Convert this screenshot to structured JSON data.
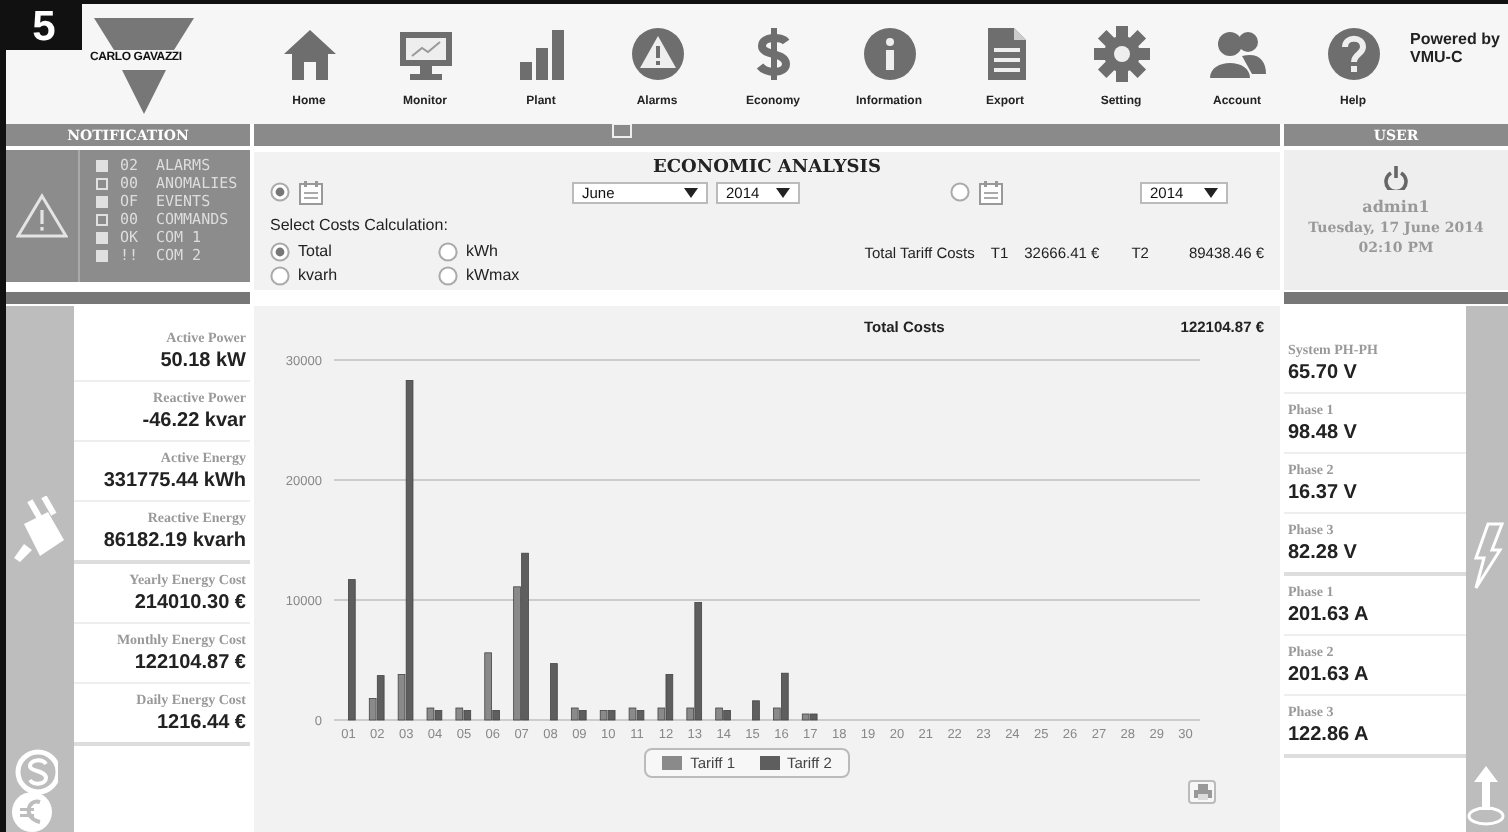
{
  "figure_badge": "5",
  "logo": "CARLO GAVAZZI",
  "nav": [
    {
      "label": "Home"
    },
    {
      "label": "Monitor"
    },
    {
      "label": "Plant"
    },
    {
      "label": "Alarms"
    },
    {
      "label": "Economy"
    },
    {
      "label": "Information"
    },
    {
      "label": "Export"
    },
    {
      "label": "Setting"
    },
    {
      "label": "Account"
    },
    {
      "label": "Help"
    }
  ],
  "powered_by": [
    "Powered by",
    "VMU-C"
  ],
  "notification": {
    "title": "NOTIFICATION",
    "items": [
      {
        "active": true,
        "code": "02",
        "label": "ALARMS"
      },
      {
        "active": false,
        "code": "00",
        "label": "ANOMALIES"
      },
      {
        "active": true,
        "code": "OF",
        "label": "EVENTS"
      },
      {
        "active": false,
        "code": "00",
        "label": "COMMANDS"
      },
      {
        "active": true,
        "code": "OK",
        "label": "COM 1"
      },
      {
        "active": true,
        "code": "!!",
        "label": "COM 2"
      }
    ]
  },
  "user": {
    "title": "USER",
    "name": "admin1",
    "date": "Tuesday, 17 June 2014",
    "time": "02:10 PM"
  },
  "analysis": {
    "title": "ECONOMIC ANALYSIS",
    "period_options": [
      {
        "selected": true,
        "month": "June",
        "year": "2014"
      },
      {
        "selected": false,
        "year": "2014"
      }
    ],
    "calc_label": "Select Costs Calculation:",
    "calc_options": [
      {
        "label": "Total",
        "selected": true
      },
      {
        "label": "kWh",
        "selected": false
      },
      {
        "label": "kvarh",
        "selected": false
      },
      {
        "label": "kWmax",
        "selected": false
      }
    ],
    "tariff_summary": {
      "label": "Total Tariff Costs",
      "t1_label": "T1",
      "t1": "32666.41 €",
      "t2_label": "T2",
      "t2": "89438.46 €"
    },
    "chart_title": "Total Costs",
    "chart_total": "122104.87 €",
    "chart_data": {
      "type": "bar",
      "categories": [
        "01",
        "02",
        "03",
        "04",
        "05",
        "06",
        "07",
        "08",
        "09",
        "10",
        "11",
        "12",
        "13",
        "14",
        "15",
        "16",
        "17",
        "18",
        "19",
        "20",
        "21",
        "22",
        "23",
        "24",
        "25",
        "26",
        "27",
        "28",
        "29",
        "30"
      ],
      "series": [
        {
          "name": "Tariff 1",
          "color": "#8a8a8a",
          "values": [
            0,
            1800,
            3800,
            1000,
            1000,
            5600,
            11100,
            0,
            1000,
            800,
            1000,
            1000,
            1000,
            1000,
            0,
            1000,
            500,
            null,
            null,
            null,
            null,
            null,
            null,
            null,
            null,
            null,
            null,
            null,
            null,
            null
          ]
        },
        {
          "name": "Tariff 2",
          "color": "#5e5e5e",
          "values": [
            11700,
            3700,
            28300,
            800,
            800,
            800,
            13900,
            4700,
            800,
            800,
            800,
            3800,
            9800,
            800,
            1600,
            3900,
            500,
            null,
            null,
            null,
            null,
            null,
            null,
            null,
            null,
            null,
            null,
            null,
            null,
            null
          ]
        }
      ],
      "ylim": [
        0,
        30000
      ],
      "yticks": [
        0,
        10000,
        20000,
        30000
      ]
    }
  },
  "left_measures": [
    [
      {
        "label": "Active Power",
        "value": "50.18 kW"
      },
      {
        "label": "Reactive Power",
        "value": "-46.22 kvar"
      },
      {
        "label": "Active Energy",
        "value": "331775.44 kWh"
      },
      {
        "label": "Reactive Energy",
        "value": "86182.19 kvarh"
      }
    ],
    [
      {
        "label": "Yearly Energy Cost",
        "value": "214010.30 €"
      },
      {
        "label": "Monthly Energy Cost",
        "value": "122104.87 €"
      },
      {
        "label": "Daily Energy Cost",
        "value": "1216.44 €"
      }
    ]
  ],
  "right_measures": [
    [
      {
        "label": "System PH-PH",
        "value": "65.70 V"
      },
      {
        "label": "Phase 1",
        "value": "98.48 V"
      },
      {
        "label": "Phase 2",
        "value": "16.37 V"
      },
      {
        "label": "Phase 3",
        "value": "82.28 V"
      }
    ],
    [
      {
        "label": "Phase 1",
        "value": "201.63 A"
      },
      {
        "label": "Phase 2",
        "value": "201.63 A"
      },
      {
        "label": "Phase 3",
        "value": "122.86 A"
      }
    ]
  ]
}
